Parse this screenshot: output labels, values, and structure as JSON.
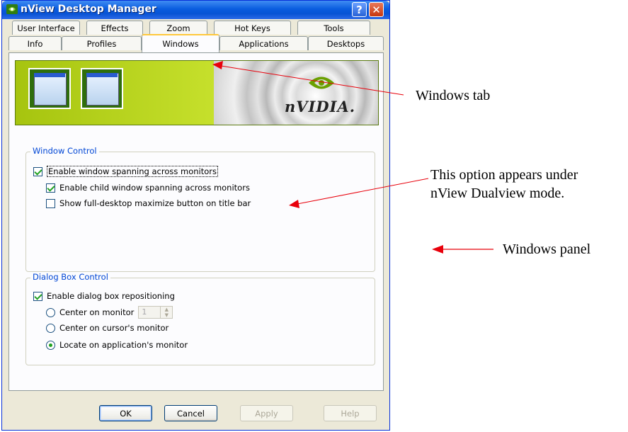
{
  "window": {
    "title": "nView Desktop Manager",
    "help_button": "?",
    "close_button": "✕"
  },
  "tabs_back_row": [
    "User Interface",
    "Effects",
    "Zoom",
    "Hot Keys",
    "Tools"
  ],
  "tabs_front_row": [
    "Info",
    "Profiles",
    "Windows",
    "Applications",
    "Desktops"
  ],
  "active_tab": "Windows",
  "banner": {
    "brand_text": "nVIDIA."
  },
  "window_control": {
    "label": "Window Control",
    "options": [
      {
        "label": "Enable window spanning across monitors",
        "checked": true
      },
      {
        "label": "Enable child window spanning across monitors",
        "checked": true
      },
      {
        "label": "Show full-desktop maximize button on title bar",
        "checked": false
      }
    ]
  },
  "dialog_box_control": {
    "label": "Dialog Box Control",
    "checkbox": {
      "label": "Enable dialog box repositioning",
      "checked": true
    },
    "radios": [
      {
        "label": "Center on monitor",
        "checked": false
      },
      {
        "label": "Center on cursor's monitor",
        "checked": false
      },
      {
        "label": "Locate on application's monitor",
        "checked": true
      }
    ],
    "monitor_value": "1"
  },
  "buttons": {
    "ok": "OK",
    "cancel": "Cancel",
    "apply": "Apply",
    "help": "Help"
  },
  "annotations": {
    "windows_tab": "Windows tab",
    "option_line1": "This option appears under",
    "option_line2": "nView Dualview mode.",
    "windows_panel": "Windows panel"
  },
  "colors": {
    "annotation_arrow": "#e8000b",
    "title_bar": "#0a5ddf",
    "group_label": "#0046d5"
  }
}
